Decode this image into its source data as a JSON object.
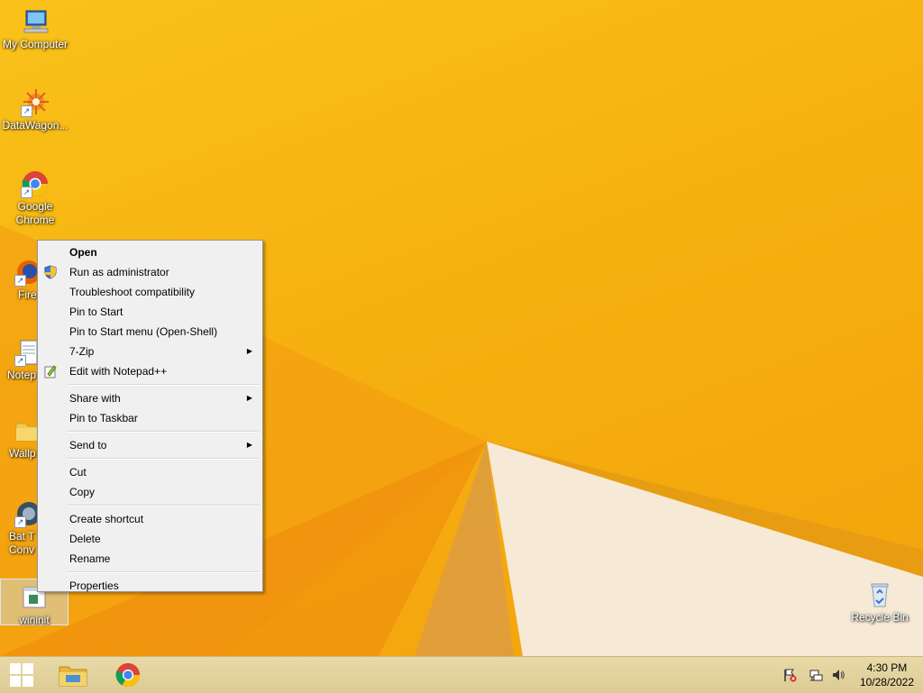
{
  "desktop": {
    "icons": [
      {
        "label": "My Computer"
      },
      {
        "label": "DataWagon..."
      },
      {
        "label": "Google Chrome"
      },
      {
        "label": "Fire"
      },
      {
        "label": "Notep"
      },
      {
        "label": "Wallp"
      },
      {
        "label": "Bat T Conv"
      },
      {
        "label": "wininit"
      },
      {
        "label": "Recycle Bin"
      }
    ]
  },
  "context_menu": {
    "items": [
      {
        "label": "Open"
      },
      {
        "label": "Run as administrator",
        "icon": "uac-shield-icon"
      },
      {
        "label": "Troubleshoot compatibility"
      },
      {
        "label": "Pin to Start"
      },
      {
        "label": "Pin to Start menu (Open-Shell)"
      },
      {
        "label": "7-Zip"
      },
      {
        "label": "Edit with Notepad++",
        "icon": "notepadpp-icon"
      },
      {
        "label": "Share with"
      },
      {
        "label": "Pin to Taskbar"
      },
      {
        "label": "Send to"
      },
      {
        "label": "Cut"
      },
      {
        "label": "Copy"
      },
      {
        "label": "Create shortcut"
      },
      {
        "label": "Delete"
      },
      {
        "label": "Rename"
      },
      {
        "label": "Properties"
      }
    ]
  },
  "taskbar": {
    "time": "4:30 PM",
    "date": "10/28/2022"
  },
  "colors": {
    "desktop_accent": "#f6b110",
    "taskbar": "#e2d29d",
    "menu_bg": "#f0f0f0"
  }
}
